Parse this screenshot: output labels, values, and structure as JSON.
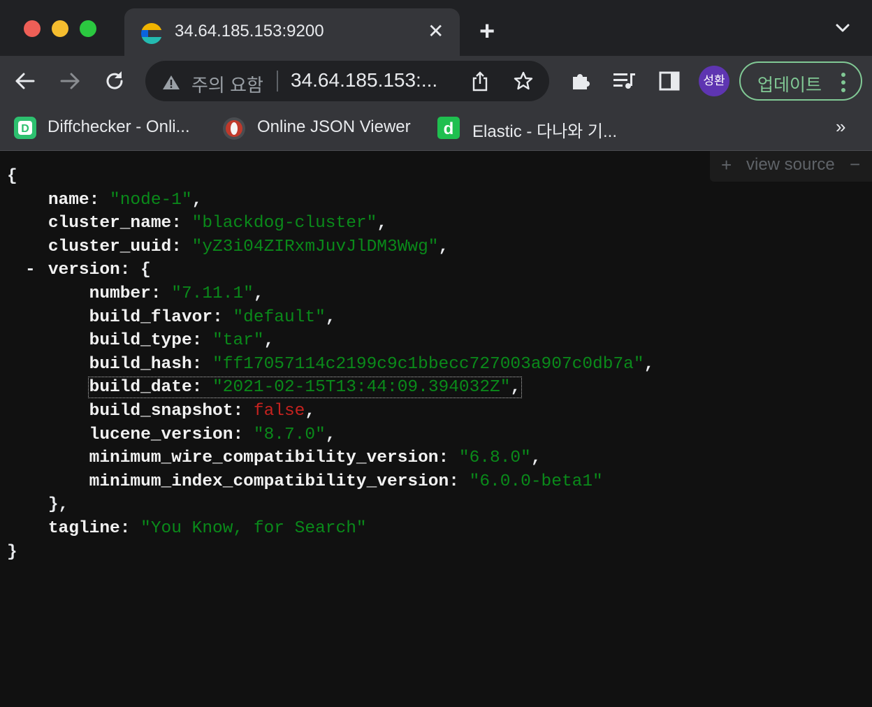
{
  "tab": {
    "title": "34.64.185.153:9200",
    "close": "✕"
  },
  "newtab": "+",
  "omnibox": {
    "security_label": "주의 요함",
    "url": "34.64.185.153:..."
  },
  "profile": {
    "avatar_text": "성환"
  },
  "update_button": {
    "label": "업데이트"
  },
  "bookmarks": [
    {
      "label": "Diffchecker - Onli..."
    },
    {
      "label": "Online JSON Viewer"
    },
    {
      "label": "Elastic - 다나와 기..."
    }
  ],
  "bookmarks_more": "»",
  "favicons": {
    "elastic_d": "d",
    "diffchecker": "D"
  },
  "view_source": {
    "plus": "+",
    "label": "view source",
    "minus": "−"
  },
  "json": {
    "open_brace": "{",
    "close_brace": "}",
    "toggle": "-",
    "version_close": "},",
    "name": {
      "key": "name",
      "value": "\"node-1\""
    },
    "cluster_name": {
      "key": "cluster_name",
      "value": "\"blackdog-cluster\""
    },
    "cluster_uuid": {
      "key": "cluster_uuid",
      "value": "\"yZ3i04ZIRxmJuvJlDM3Wwg\""
    },
    "version_key": "version",
    "version": [
      {
        "key": "number",
        "value": "\"7.11.1\"",
        "type": "string"
      },
      {
        "key": "build_flavor",
        "value": "\"default\"",
        "type": "string"
      },
      {
        "key": "build_type",
        "value": "\"tar\"",
        "type": "string"
      },
      {
        "key": "build_hash",
        "value": "\"ff17057114c2199c9c1bbecc727003a907c0db7a\"",
        "type": "string"
      },
      {
        "key": "build_date",
        "value": "\"2021-02-15T13:44:09.394032Z\"",
        "type": "string"
      },
      {
        "key": "build_snapshot",
        "value": "false",
        "type": "bool"
      },
      {
        "key": "lucene_version",
        "value": "\"8.7.0\"",
        "type": "string"
      },
      {
        "key": "minimum_wire_compatibility_version",
        "value": "\"6.8.0\"",
        "type": "string"
      },
      {
        "key": "minimum_index_compatibility_version",
        "value": "\"6.0.0-beta1\"",
        "type": "string"
      }
    ],
    "tagline": {
      "key": "tagline",
      "value": "\"You Know, for Search\""
    }
  },
  "colors": {
    "string": "#0a8a1a",
    "boolean": "#c5221f",
    "update_accent": "#81c995",
    "avatar": "#5e35b1"
  }
}
